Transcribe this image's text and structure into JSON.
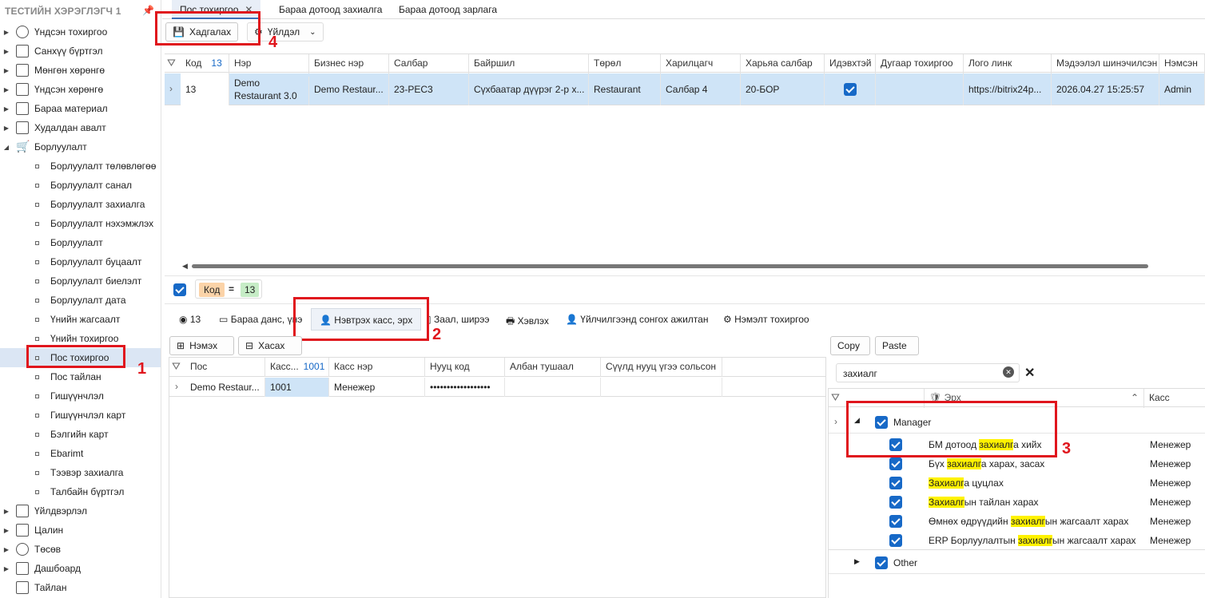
{
  "sidebar": {
    "title": "ТЕСТИЙН ХЭРЭГЛЭГЧ 1",
    "items": [
      {
        "label": "Үндсэн тохиргоо",
        "icon": "gear-icon"
      },
      {
        "label": "Санхүү бүртгэл",
        "icon": "ledger-icon"
      },
      {
        "label": "Мөнгөн хөрөнгө",
        "icon": "money-icon"
      },
      {
        "label": "Үндсэн хөрөнгө",
        "icon": "asset-icon"
      },
      {
        "label": "Бараа материал",
        "icon": "inventory-icon"
      },
      {
        "label": "Худалдан авалт",
        "icon": "purchase-icon"
      },
      {
        "label": "Борлуулалт",
        "icon": "cart-icon"
      }
    ],
    "sub_items": [
      "Борлуулалт төлөвлөгөө",
      "Борлуулалт санал",
      "Борлуулалт захиалга",
      "Борлуулалт нэхэмжлэх",
      "Борлуулалт",
      "Борлуулалт буцаалт",
      "Борлуулалт биелэлт",
      "Борлуулалт дата",
      "Үнийн жагсаалт",
      "Үнийн тохиргоо",
      "Пос тохиргоо",
      "Пос тайлан",
      "Гишүүнчлэл",
      "Гишүүнчлэл карт",
      "Бэлгийн карт",
      "Ebarimt",
      "Тээвэр захиалга",
      "Талбайн бүртгэл"
    ],
    "bottom_items": [
      {
        "label": "Үйлдвэрлэл",
        "icon": "factory-icon"
      },
      {
        "label": "Цалин",
        "icon": "salary-icon"
      },
      {
        "label": "Төсөв",
        "icon": "budget-icon"
      },
      {
        "label": "Дашбоард",
        "icon": "dashboard-icon"
      },
      {
        "label": "Тайлан",
        "icon": "report-icon"
      }
    ]
  },
  "tabs": [
    "Пос тохиргоо",
    "Бараа дотоод захиалга",
    "Бараа дотоод зарлага"
  ],
  "toolbar": {
    "save": "Хадгалах",
    "actions": "Үйлдэл"
  },
  "grid": {
    "headers": [
      "Код",
      "Нэр",
      "Бизнес нэр",
      "Салбар",
      "Байршил",
      "Төрөл",
      "Харилцагч",
      "Харьяа салбар",
      "Идэвхтэй",
      "Дугаар тохиргоо",
      "Лого линк",
      "Мэдээлэл шинэчилсэн",
      "Нэмсэн"
    ],
    "code_count": "13",
    "row": {
      "code": "13",
      "name": "Demo Restaurant 3.0",
      "business": "Demo Restaur...",
      "branch": "23-РЕС3",
      "location": "Сүхбаатар дүүрэг 2-р х...",
      "type": "Restaurant",
      "partner": "Салбар 4",
      "sub_branch": "20-БОР",
      "active": true,
      "logo": "https://bitrix24p...",
      "updated": "2026.04.27 15:25:57",
      "added": "Admin"
    }
  },
  "filter": {
    "field": "Код",
    "op": "=",
    "value": "13"
  },
  "detail_tabs": {
    "count": "13",
    "items": [
      "Бараа данс, үнэ",
      "Нэвтрэх касс, эрх",
      "Заал, ширээ",
      "Хэвлэх",
      "Үйлчилгээнд сонгох ажилтан",
      "Нэмэлт тохиргоо"
    ]
  },
  "cashier": {
    "add": "Нэмэх",
    "remove": "Хасах",
    "headers": [
      "Пос",
      "Касс...",
      "Касс нэр",
      "Нууц код",
      "Албан тушаал",
      "Сүүлд нууц үгээ сольсон"
    ],
    "kass_count": "1001",
    "row": {
      "pos": "Demo Restaur...",
      "kass": "1001",
      "name": "Менежер",
      "password": "••••••••••••••••••"
    }
  },
  "rights": {
    "copy": "Copy",
    "paste": "Paste",
    "search": "захиалг",
    "headers": [
      "Эрх",
      "Касс"
    ],
    "groups": [
      "Manager",
      "Other"
    ],
    "items": [
      {
        "pre": "БМ дотоод ",
        "hl": "захиалг",
        "post": "а хийх",
        "role": "Менежер"
      },
      {
        "pre": "Бүх ",
        "hl": "захиалг",
        "post": "а харах, засах",
        "role": "Менежер"
      },
      {
        "pre": "",
        "hl": "Захиалг",
        "post": "а цуцлах",
        "role": "Менежер"
      },
      {
        "pre": "",
        "hl": "Захиалг",
        "post": "ын тайлан харах",
        "role": "Менежер"
      },
      {
        "pre": "Өмнөх өдрүүдийн ",
        "hl": "захиалг",
        "post": "ын жагсаалт харах",
        "role": "Менежер"
      },
      {
        "pre": "ERP Борлуулалтын ",
        "hl": "захиалг",
        "post": "ын жагсаалт харах",
        "role": "Менежер"
      }
    ]
  },
  "annotations": [
    "1",
    "2",
    "3",
    "4"
  ],
  "colors": {
    "highlight_red": "#e0161d",
    "accent": "#1769c7",
    "selected_row": "#cfe4f7"
  }
}
